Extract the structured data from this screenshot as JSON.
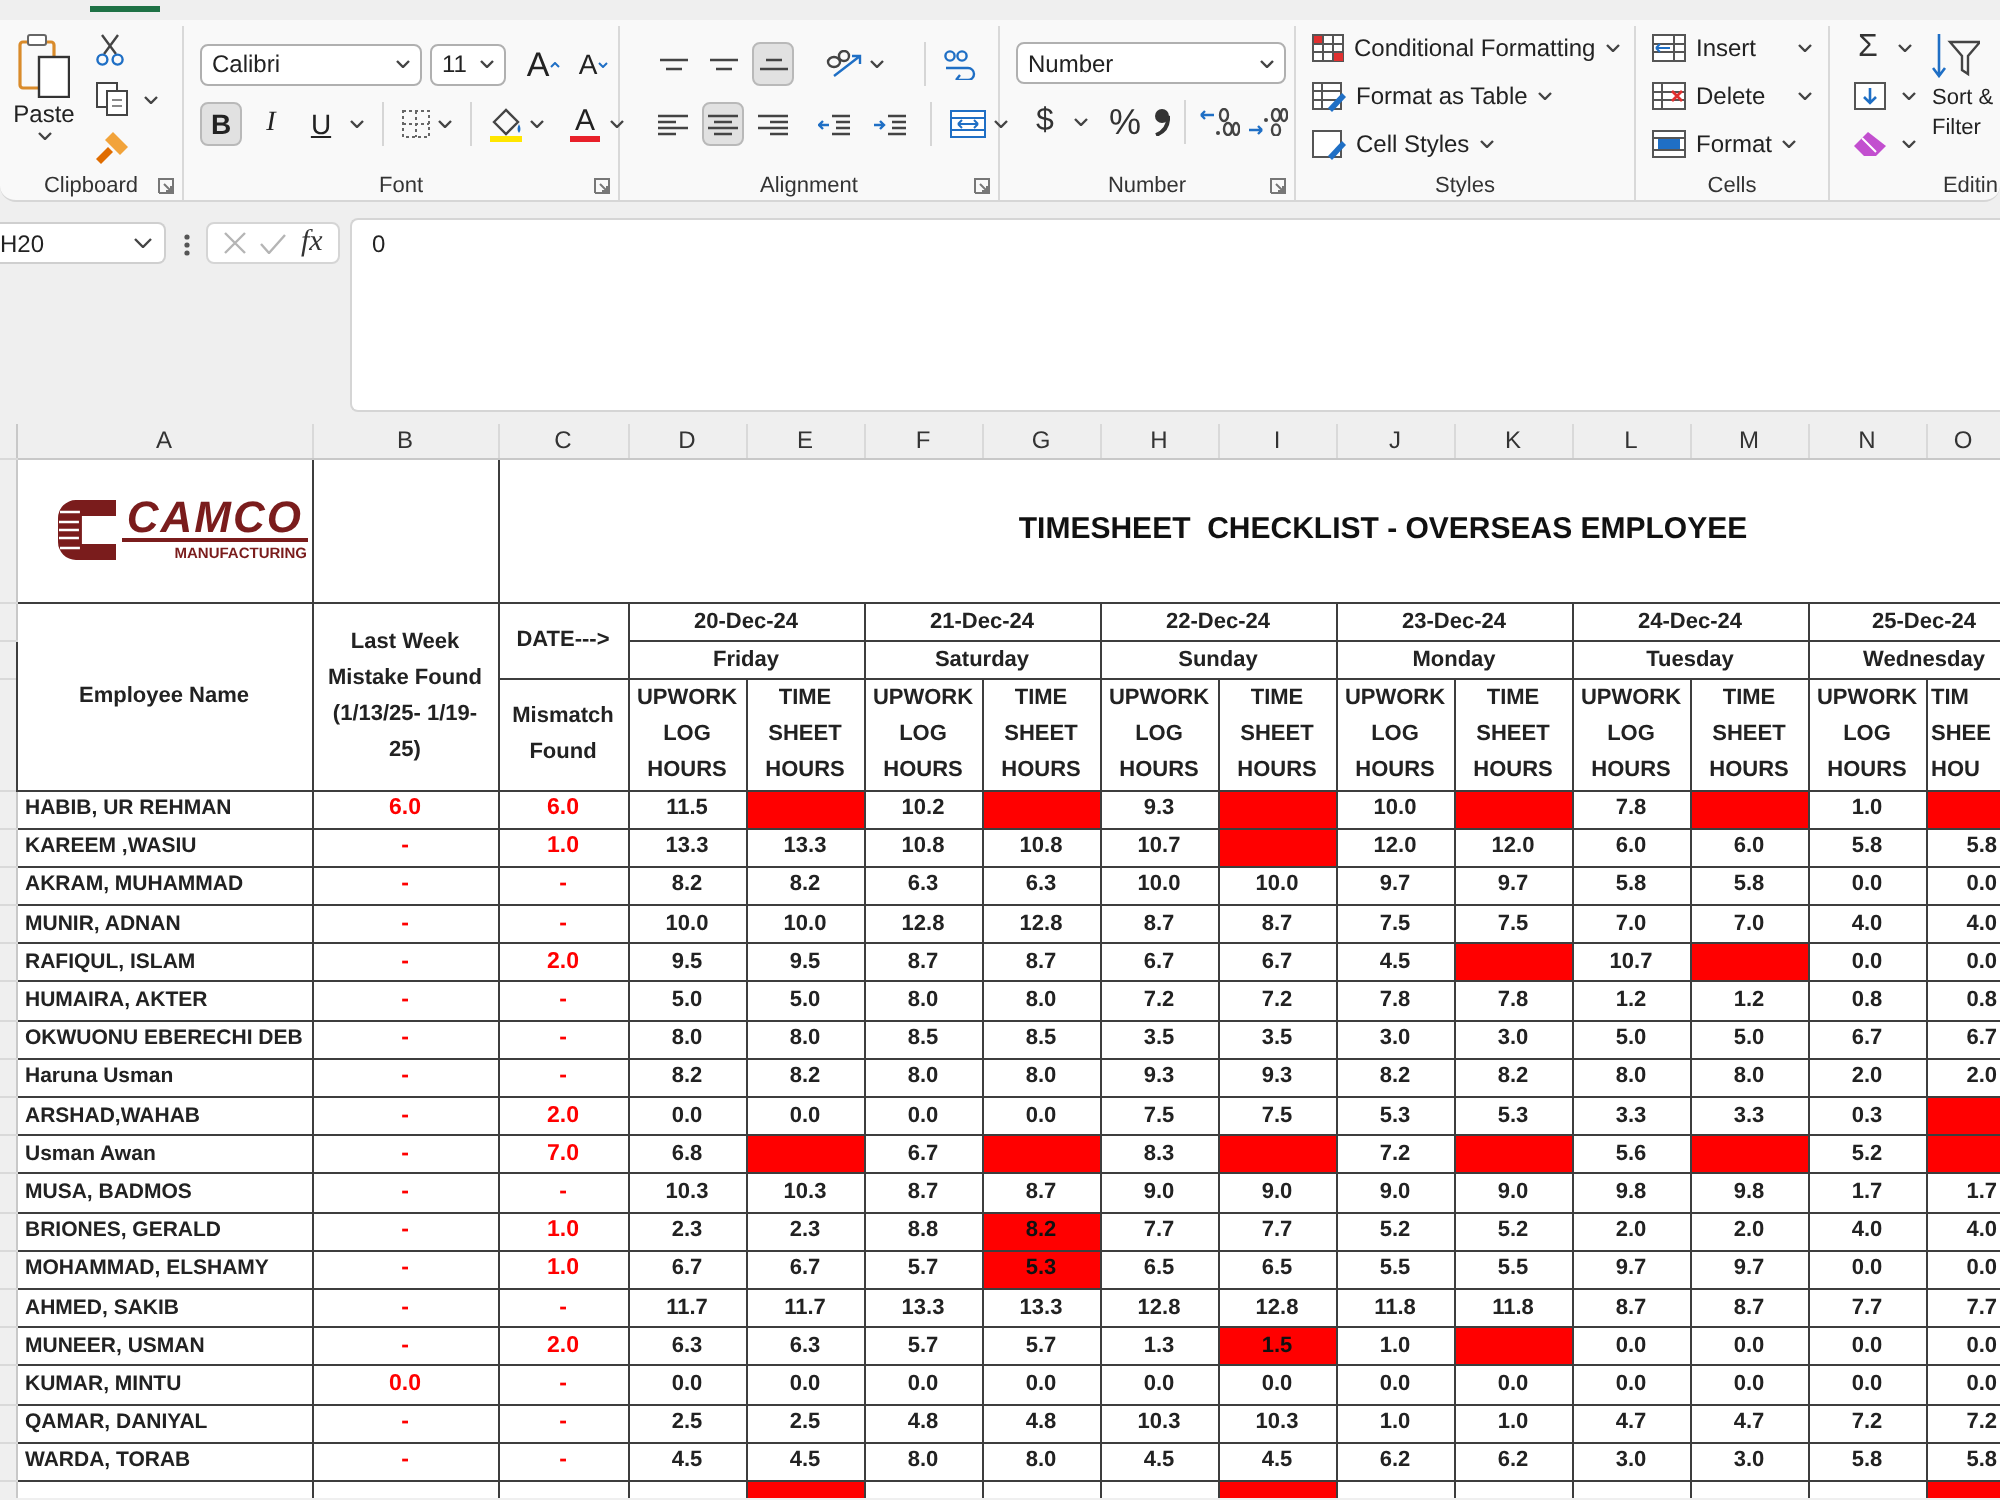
{
  "ribbon_tabs": [
    {
      "selected": true
    }
  ],
  "ribbon": {
    "clipboard": {
      "label": "Clipboard",
      "paste": "Paste"
    },
    "font": {
      "label": "Font",
      "font_name": "Calibri",
      "font_size": "11",
      "grow": "A",
      "shrink": "A",
      "styles": [
        {
          "text": "B",
          "on": true
        },
        {
          "text": "I",
          "on": false
        },
        {
          "text": "U",
          "on": false
        }
      ],
      "font_color": "A"
    },
    "alignment": {
      "label": "Alignment",
      "vertical": [
        {
          "kind": "top",
          "selected": false
        },
        {
          "kind": "middle",
          "selected": false
        },
        {
          "kind": "bottom",
          "selected": true
        }
      ],
      "horizontal": [
        {
          "kind": "left",
          "selected": false
        },
        {
          "kind": "center",
          "selected": true
        },
        {
          "kind": "right",
          "selected": false
        }
      ]
    },
    "number": {
      "label": "Number",
      "format": "Number",
      "currency": "$",
      "percent": "%"
    },
    "styles": {
      "label": "Styles",
      "items": [
        {
          "kind": "conditional",
          "text": "Conditional Formatting"
        },
        {
          "kind": "table",
          "text": "Format as Table"
        },
        {
          "kind": "cell",
          "text": "Cell Styles"
        }
      ]
    },
    "cells": {
      "label": "Cells",
      "items": [
        {
          "kind": "insert",
          "text": "Insert"
        },
        {
          "kind": "delete",
          "text": "Delete"
        },
        {
          "kind": "format",
          "text": "Format"
        }
      ]
    },
    "editing": {
      "label": "Editin",
      "autosum": "Σ",
      "sort_filter": "Sort & Filter"
    }
  },
  "formula_bar": {
    "name_box": "H20",
    "fx": "fx",
    "content": "0"
  },
  "columns": [
    "A",
    "B",
    "C",
    "D",
    "E",
    "F",
    "G",
    "H",
    "I",
    "J",
    "K",
    "L",
    "M",
    "N",
    "O"
  ],
  "sheet": {
    "logo": {
      "wordmark": "CAMCO",
      "tagline": "MANUFACTURING"
    },
    "title": "TIMESHEET  CHECKLIST - OVERSEAS EMPLOYEE",
    "headers": {
      "name": "Employee Name",
      "last_week": "Last Week Mistake Found (1/13/25- 1/19-25)",
      "date": "DATE--->",
      "mismatch": "Mismatch Found"
    },
    "days": [
      {
        "date": "20-Dec-24",
        "weekday": "Friday",
        "upwork": "UPWORK LOG HOURS",
        "timesheet": "TIME SHEET HOURS"
      },
      {
        "date": "21-Dec-24",
        "weekday": "Saturday",
        "upwork": "UPWORK LOG HOURS",
        "timesheet": "TIME SHEET HOURS"
      },
      {
        "date": "22-Dec-24",
        "weekday": "Sunday",
        "upwork": "UPWORK LOG HOURS",
        "timesheet": "TIME SHEET HOURS"
      },
      {
        "date": "23-Dec-24",
        "weekday": "Monday",
        "upwork": "UPWORK LOG HOURS",
        "timesheet": "TIME SHEET HOURS"
      },
      {
        "date": "24-Dec-24",
        "weekday": "Tuesday",
        "upwork": "UPWORK LOG HOURS",
        "timesheet": "TIME SHEET HOURS"
      },
      {
        "date": "25-Dec-24",
        "weekday": "Wednesday",
        "upwork": "UPWORK LOG HOURS",
        "timesheet": "TIM SHEE HOU"
      }
    ],
    "rows": [
      {
        "name": "HABIB, UR REHMAN",
        "last_week": "6.0",
        "mismatch": "6.0",
        "cells": [
          {
            "value": "11.5",
            "flagged": false
          },
          {
            "flagged": true
          },
          {
            "value": "10.2",
            "flagged": false
          },
          {
            "flagged": true
          },
          {
            "value": "9.3",
            "flagged": false
          },
          {
            "flagged": true
          },
          {
            "value": "10.0",
            "flagged": false
          },
          {
            "flagged": true
          },
          {
            "value": "7.8",
            "flagged": false
          },
          {
            "flagged": true
          },
          {
            "value": "1.0",
            "flagged": false
          },
          {
            "flagged": true
          }
        ]
      },
      {
        "name": "KAREEM ,WASIU",
        "last_week": "-",
        "mismatch": "1.0",
        "cells": [
          {
            "value": "13.3",
            "flagged": false
          },
          {
            "value": "13.3",
            "flagged": false
          },
          {
            "value": "10.8",
            "flagged": false
          },
          {
            "value": "10.8",
            "flagged": false
          },
          {
            "value": "10.7",
            "flagged": false
          },
          {
            "flagged": true
          },
          {
            "value": "12.0",
            "flagged": false
          },
          {
            "value": "12.0",
            "flagged": false
          },
          {
            "value": "6.0",
            "flagged": false
          },
          {
            "value": "6.0",
            "flagged": false
          },
          {
            "value": "5.8",
            "flagged": false
          },
          {
            "value": "5.8",
            "flagged": false
          }
        ]
      },
      {
        "name": "AKRAM, MUHAMMAD",
        "last_week": "-",
        "mismatch": "-",
        "cells": [
          {
            "value": "8.2",
            "flagged": false
          },
          {
            "value": "8.2",
            "flagged": false
          },
          {
            "value": "6.3",
            "flagged": false
          },
          {
            "value": "6.3",
            "flagged": false
          },
          {
            "value": "10.0",
            "flagged": false
          },
          {
            "value": "10.0",
            "flagged": false
          },
          {
            "value": "9.7",
            "flagged": false
          },
          {
            "value": "9.7",
            "flagged": false
          },
          {
            "value": "5.8",
            "flagged": false
          },
          {
            "value": "5.8",
            "flagged": false
          },
          {
            "value": "0.0",
            "flagged": false
          },
          {
            "value": "0.0",
            "flagged": false
          }
        ]
      },
      {
        "name": "MUNIR, ADNAN",
        "last_week": "-",
        "mismatch": "-",
        "cells": [
          {
            "value": "10.0",
            "flagged": false
          },
          {
            "value": "10.0",
            "flagged": false
          },
          {
            "value": "12.8",
            "flagged": false
          },
          {
            "value": "12.8",
            "flagged": false
          },
          {
            "value": "8.7",
            "flagged": false
          },
          {
            "value": "8.7",
            "flagged": false
          },
          {
            "value": "7.5",
            "flagged": false
          },
          {
            "value": "7.5",
            "flagged": false
          },
          {
            "value": "7.0",
            "flagged": false
          },
          {
            "value": "7.0",
            "flagged": false
          },
          {
            "value": "4.0",
            "flagged": false
          },
          {
            "value": "4.0",
            "flagged": false
          }
        ]
      },
      {
        "name": "RAFIQUL, ISLAM",
        "last_week": "-",
        "mismatch": "2.0",
        "cells": [
          {
            "value": "9.5",
            "flagged": false
          },
          {
            "value": "9.5",
            "flagged": false
          },
          {
            "value": "8.7",
            "flagged": false
          },
          {
            "value": "8.7",
            "flagged": false
          },
          {
            "value": "6.7",
            "flagged": false
          },
          {
            "value": "6.7",
            "flagged": false
          },
          {
            "value": "4.5",
            "flagged": false
          },
          {
            "flagged": true
          },
          {
            "value": "10.7",
            "flagged": false
          },
          {
            "flagged": true
          },
          {
            "value": "0.0",
            "flagged": false
          },
          {
            "value": "0.0",
            "flagged": false
          }
        ]
      },
      {
        "name": "HUMAIRA, AKTER",
        "last_week": "-",
        "mismatch": "-",
        "cells": [
          {
            "value": "5.0",
            "flagged": false
          },
          {
            "value": "5.0",
            "flagged": false
          },
          {
            "value": "8.0",
            "flagged": false
          },
          {
            "value": "8.0",
            "flagged": false
          },
          {
            "value": "7.2",
            "flagged": false
          },
          {
            "value": "7.2",
            "flagged": false
          },
          {
            "value": "7.8",
            "flagged": false
          },
          {
            "value": "7.8",
            "flagged": false
          },
          {
            "value": "1.2",
            "flagged": false
          },
          {
            "value": "1.2",
            "flagged": false
          },
          {
            "value": "0.8",
            "flagged": false
          },
          {
            "value": "0.8",
            "flagged": false
          }
        ]
      },
      {
        "name": "OKWUONU EBERECHI DEB",
        "last_week": "-",
        "mismatch": "-",
        "cells": [
          {
            "value": "8.0",
            "flagged": false
          },
          {
            "value": "8.0",
            "flagged": false
          },
          {
            "value": "8.5",
            "flagged": false
          },
          {
            "value": "8.5",
            "flagged": false
          },
          {
            "value": "3.5",
            "flagged": false
          },
          {
            "value": "3.5",
            "flagged": false
          },
          {
            "value": "3.0",
            "flagged": false
          },
          {
            "value": "3.0",
            "flagged": false
          },
          {
            "value": "5.0",
            "flagged": false
          },
          {
            "value": "5.0",
            "flagged": false
          },
          {
            "value": "6.7",
            "flagged": false
          },
          {
            "value": "6.7",
            "flagged": false
          }
        ]
      },
      {
        "name": "Haruna Usman",
        "last_week": "-",
        "mismatch": "-",
        "cells": [
          {
            "value": "8.2",
            "flagged": false
          },
          {
            "value": "8.2",
            "flagged": false
          },
          {
            "value": "8.0",
            "flagged": false
          },
          {
            "value": "8.0",
            "flagged": false
          },
          {
            "value": "9.3",
            "flagged": false
          },
          {
            "value": "9.3",
            "flagged": false
          },
          {
            "value": "8.2",
            "flagged": false
          },
          {
            "value": "8.2",
            "flagged": false
          },
          {
            "value": "8.0",
            "flagged": false
          },
          {
            "value": "8.0",
            "flagged": false
          },
          {
            "value": "2.0",
            "flagged": false
          },
          {
            "value": "2.0",
            "flagged": false
          }
        ]
      },
      {
        "name": "ARSHAD,WAHAB",
        "last_week": "-",
        "mismatch": "2.0",
        "cells": [
          {
            "value": "0.0",
            "flagged": false
          },
          {
            "value": "0.0",
            "flagged": false
          },
          {
            "value": "0.0",
            "flagged": false
          },
          {
            "value": "0.0",
            "flagged": false
          },
          {
            "value": "7.5",
            "flagged": false
          },
          {
            "value": "7.5",
            "flagged": false
          },
          {
            "value": "5.3",
            "flagged": false
          },
          {
            "value": "5.3",
            "flagged": false
          },
          {
            "value": "3.3",
            "flagged": false
          },
          {
            "value": "3.3",
            "flagged": false
          },
          {
            "value": "0.3",
            "flagged": false
          },
          {
            "flagged": true
          }
        ]
      },
      {
        "name": "Usman Awan",
        "last_week": "-",
        "mismatch": "7.0",
        "cells": [
          {
            "value": "6.8",
            "flagged": false
          },
          {
            "flagged": true
          },
          {
            "value": "6.7",
            "flagged": false
          },
          {
            "flagged": true
          },
          {
            "value": "8.3",
            "flagged": false
          },
          {
            "flagged": true
          },
          {
            "value": "7.2",
            "flagged": false
          },
          {
            "flagged": true
          },
          {
            "value": "5.6",
            "flagged": false
          },
          {
            "flagged": true
          },
          {
            "value": "5.2",
            "flagged": false
          },
          {
            "flagged": true
          }
        ]
      },
      {
        "name": "MUSA, BADMOS",
        "last_week": "-",
        "mismatch": "-",
        "cells": [
          {
            "value": "10.3",
            "flagged": false
          },
          {
            "value": "10.3",
            "flagged": false
          },
          {
            "value": "8.7",
            "flagged": false
          },
          {
            "value": "8.7",
            "flagged": false
          },
          {
            "value": "9.0",
            "flagged": false
          },
          {
            "value": "9.0",
            "flagged": false
          },
          {
            "value": "9.0",
            "flagged": false
          },
          {
            "value": "9.0",
            "flagged": false
          },
          {
            "value": "9.8",
            "flagged": false
          },
          {
            "value": "9.8",
            "flagged": false
          },
          {
            "value": "1.7",
            "flagged": false
          },
          {
            "value": "1.7",
            "flagged": false
          }
        ]
      },
      {
        "name": "BRIONES, GERALD",
        "last_week": "-",
        "mismatch": "1.0",
        "cells": [
          {
            "value": "2.3",
            "flagged": false
          },
          {
            "value": "2.3",
            "flagged": false
          },
          {
            "value": "8.8",
            "flagged": false
          },
          {
            "value": "8.2",
            "flagged": true
          },
          {
            "value": "7.7",
            "flagged": false
          },
          {
            "value": "7.7",
            "flagged": false
          },
          {
            "value": "5.2",
            "flagged": false
          },
          {
            "value": "5.2",
            "flagged": false
          },
          {
            "value": "2.0",
            "flagged": false
          },
          {
            "value": "2.0",
            "flagged": false
          },
          {
            "value": "4.0",
            "flagged": false
          },
          {
            "value": "4.0",
            "flagged": false
          }
        ]
      },
      {
        "name": "MOHAMMAD, ELSHAMY",
        "last_week": "-",
        "mismatch": "1.0",
        "cells": [
          {
            "value": "6.7",
            "flagged": false
          },
          {
            "value": "6.7",
            "flagged": false
          },
          {
            "value": "5.7",
            "flagged": false
          },
          {
            "value": "5.3",
            "flagged": true
          },
          {
            "value": "6.5",
            "flagged": false
          },
          {
            "value": "6.5",
            "flagged": false
          },
          {
            "value": "5.5",
            "flagged": false
          },
          {
            "value": "5.5",
            "flagged": false
          },
          {
            "value": "9.7",
            "flagged": false
          },
          {
            "value": "9.7",
            "flagged": false
          },
          {
            "value": "0.0",
            "flagged": false
          },
          {
            "value": "0.0",
            "flagged": false
          }
        ]
      },
      {
        "name": "AHMED, SAKIB",
        "last_week": "-",
        "mismatch": "-",
        "cells": [
          {
            "value": "11.7",
            "flagged": false
          },
          {
            "value": "11.7",
            "flagged": false
          },
          {
            "value": "13.3",
            "flagged": false
          },
          {
            "value": "13.3",
            "flagged": false
          },
          {
            "value": "12.8",
            "flagged": false
          },
          {
            "value": "12.8",
            "flagged": false
          },
          {
            "value": "11.8",
            "flagged": false
          },
          {
            "value": "11.8",
            "flagged": false
          },
          {
            "value": "8.7",
            "flagged": false
          },
          {
            "value": "8.7",
            "flagged": false
          },
          {
            "value": "7.7",
            "flagged": false
          },
          {
            "value": "7.7",
            "flagged": false
          }
        ]
      },
      {
        "name": "MUNEER, USMAN",
        "last_week": "-",
        "mismatch": "2.0",
        "cells": [
          {
            "value": "6.3",
            "flagged": false
          },
          {
            "value": "6.3",
            "flagged": false
          },
          {
            "value": "5.7",
            "flagged": false
          },
          {
            "value": "5.7",
            "flagged": false
          },
          {
            "value": "1.3",
            "flagged": false
          },
          {
            "value": "1.5",
            "flagged": true
          },
          {
            "value": "1.0",
            "flagged": false
          },
          {
            "flagged": true
          },
          {
            "value": "0.0",
            "flagged": false
          },
          {
            "value": "0.0",
            "flagged": false
          },
          {
            "value": "0.0",
            "flagged": false
          },
          {
            "value": "0.0",
            "flagged": false
          }
        ]
      },
      {
        "name": "KUMAR, MINTU",
        "last_week": "0.0",
        "mismatch": "-",
        "cells": [
          {
            "value": "0.0",
            "flagged": false
          },
          {
            "value": "0.0",
            "flagged": false
          },
          {
            "value": "0.0",
            "flagged": false
          },
          {
            "value": "0.0",
            "flagged": false
          },
          {
            "value": "0.0",
            "flagged": false
          },
          {
            "value": "0.0",
            "flagged": false
          },
          {
            "value": "0.0",
            "flagged": false
          },
          {
            "value": "0.0",
            "flagged": false
          },
          {
            "value": "0.0",
            "flagged": false
          },
          {
            "value": "0.0",
            "flagged": false
          },
          {
            "value": "0.0",
            "flagged": false
          },
          {
            "value": "0.0",
            "flagged": false
          }
        ]
      },
      {
        "name": "QAMAR, DANIYAL",
        "last_week": "-",
        "mismatch": "-",
        "cells": [
          {
            "value": "2.5",
            "flagged": false
          },
          {
            "value": "2.5",
            "flagged": false
          },
          {
            "value": "4.8",
            "flagged": false
          },
          {
            "value": "4.8",
            "flagged": false
          },
          {
            "value": "10.3",
            "flagged": false
          },
          {
            "value": "10.3",
            "flagged": false
          },
          {
            "value": "1.0",
            "flagged": false
          },
          {
            "value": "1.0",
            "flagged": false
          },
          {
            "value": "4.7",
            "flagged": false
          },
          {
            "value": "4.7",
            "flagged": false
          },
          {
            "value": "7.2",
            "flagged": false
          },
          {
            "value": "7.2",
            "flagged": false
          }
        ]
      },
      {
        "name": "WARDA, TORAB",
        "last_week": "-",
        "mismatch": "-",
        "cells": [
          {
            "value": "4.5",
            "flagged": false
          },
          {
            "value": "4.5",
            "flagged": false
          },
          {
            "value": "8.0",
            "flagged": false
          },
          {
            "value": "8.0",
            "flagged": false
          },
          {
            "value": "4.5",
            "flagged": false
          },
          {
            "value": "4.5",
            "flagged": false
          },
          {
            "value": "6.2",
            "flagged": false
          },
          {
            "value": "6.2",
            "flagged": false
          },
          {
            "value": "3.0",
            "flagged": false
          },
          {
            "value": "3.0",
            "flagged": false
          },
          {
            "value": "5.8",
            "flagged": false
          },
          {
            "value": "5.8",
            "flagged": false
          }
        ]
      },
      {
        "cells": [
          {
            "flagged": false
          },
          {
            "flagged": true
          },
          {
            "flagged": false
          },
          {
            "flagged": false
          },
          {
            "flagged": false
          },
          {
            "flagged": true
          },
          {
            "flagged": false
          },
          {
            "flagged": false
          },
          {
            "flagged": false
          },
          {
            "flagged": false
          },
          {
            "flagged": false
          },
          {
            "flagged": true
          }
        ]
      }
    ]
  }
}
